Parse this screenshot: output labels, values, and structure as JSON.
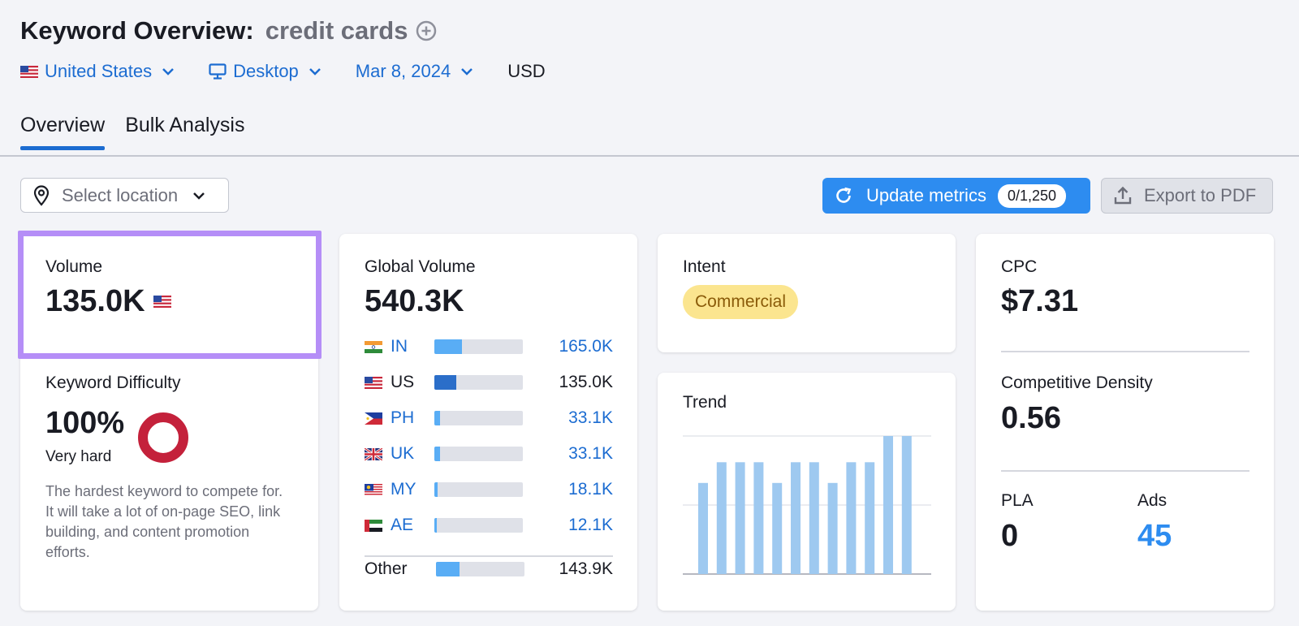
{
  "header": {
    "title": "Keyword Overview:",
    "keyword": "credit cards",
    "filters": {
      "country": "United States",
      "device": "Desktop",
      "date": "Mar 8, 2024",
      "currency": "USD"
    }
  },
  "tabs": [
    {
      "label": "Overview",
      "active": true
    },
    {
      "label": "Bulk Analysis",
      "active": false
    }
  ],
  "toolbar": {
    "location_placeholder": "Select location",
    "update_label": "Update metrics",
    "update_counter": "0/1,250",
    "export_label": "Export to PDF"
  },
  "volume": {
    "label": "Volume",
    "value": "135.0K"
  },
  "keyword_difficulty": {
    "label": "Keyword Difficulty",
    "value": "100%",
    "level": "Very hard",
    "percent": 100,
    "description": "The hardest keyword to compete for. It will take a lot of on-page SEO, link building, and content promotion efforts.",
    "color": "#c4213b"
  },
  "global_volume": {
    "label": "Global Volume",
    "value": "540.3K",
    "countries": [
      {
        "code": "IN",
        "value": "165.0K",
        "share": 0.31
      },
      {
        "code": "US",
        "value": "135.0K",
        "share": 0.25
      },
      {
        "code": "PH",
        "value": "33.1K",
        "share": 0.06
      },
      {
        "code": "UK",
        "value": "33.1K",
        "share": 0.06
      },
      {
        "code": "MY",
        "value": "18.1K",
        "share": 0.04
      },
      {
        "code": "AE",
        "value": "12.1K",
        "share": 0.03
      }
    ],
    "other": {
      "label": "Other",
      "value": "143.9K",
      "share": 0.27
    }
  },
  "intent": {
    "label": "Intent",
    "value": "Commercial"
  },
  "trend": {
    "label": "Trend",
    "values": [
      0.66,
      0.81,
      0.81,
      0.81,
      0.66,
      0.81,
      0.81,
      0.66,
      0.81,
      0.81,
      1.0,
      1.0
    ],
    "bar_color": "#9ec9f0"
  },
  "cpc": {
    "label": "CPC",
    "value": "$7.31"
  },
  "competitive_density": {
    "label": "Competitive Density",
    "value": "0.56"
  },
  "pla": {
    "label": "PLA",
    "value": "0"
  },
  "ads": {
    "label": "Ads",
    "value": "45"
  }
}
